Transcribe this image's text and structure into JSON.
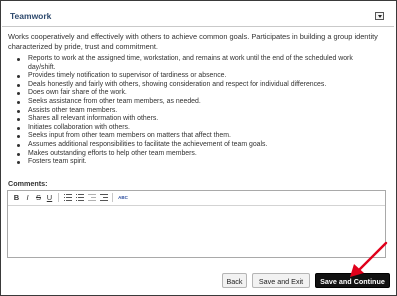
{
  "section": {
    "title": "Teamwork",
    "collapse_icon": "chevron-down-icon"
  },
  "description": "Works cooperatively and effectively with others to achieve common goals. Participates in building a group identity characterized by pride, trust and commitment.",
  "items": [
    "Reports to work at the assigned time, workstation, and remains at work until the end of the scheduled work day/shift.",
    "Provides timely notification to supervisor of tardiness or absence.",
    "Deals honestly and fairly with others, showing consideration and respect for individual differences.",
    "Does own fair share of the work.",
    "Seeks assistance from other team members, as needed.",
    "Assists other team members.",
    "Shares all relevant information with others.",
    "Initiates collaboration with others.",
    "Seeks input from other team members on matters that affect them.",
    "Assumes additional responsibilities to facilitate the achievement of team goals.",
    "Makes outstanding efforts to help other team members.",
    "Fosters team spirit."
  ],
  "comments": {
    "label": "Comments:",
    "value": "",
    "toolbar": {
      "bold": "B",
      "italic": "I",
      "strike": "S",
      "underline": "U",
      "icons": [
        "bold-icon",
        "italic-icon",
        "strikethrough-icon",
        "underline-icon",
        "ordered-list-icon",
        "unordered-list-icon",
        "outdent-icon",
        "indent-icon",
        "spellcheck-icon"
      ],
      "spellcheck": "ABC"
    }
  },
  "buttons": {
    "back": "Back",
    "save_exit": "Save and Exit",
    "save_continue": "Save and Continue"
  },
  "annotation": {
    "arrow_color": "#e0001b"
  }
}
